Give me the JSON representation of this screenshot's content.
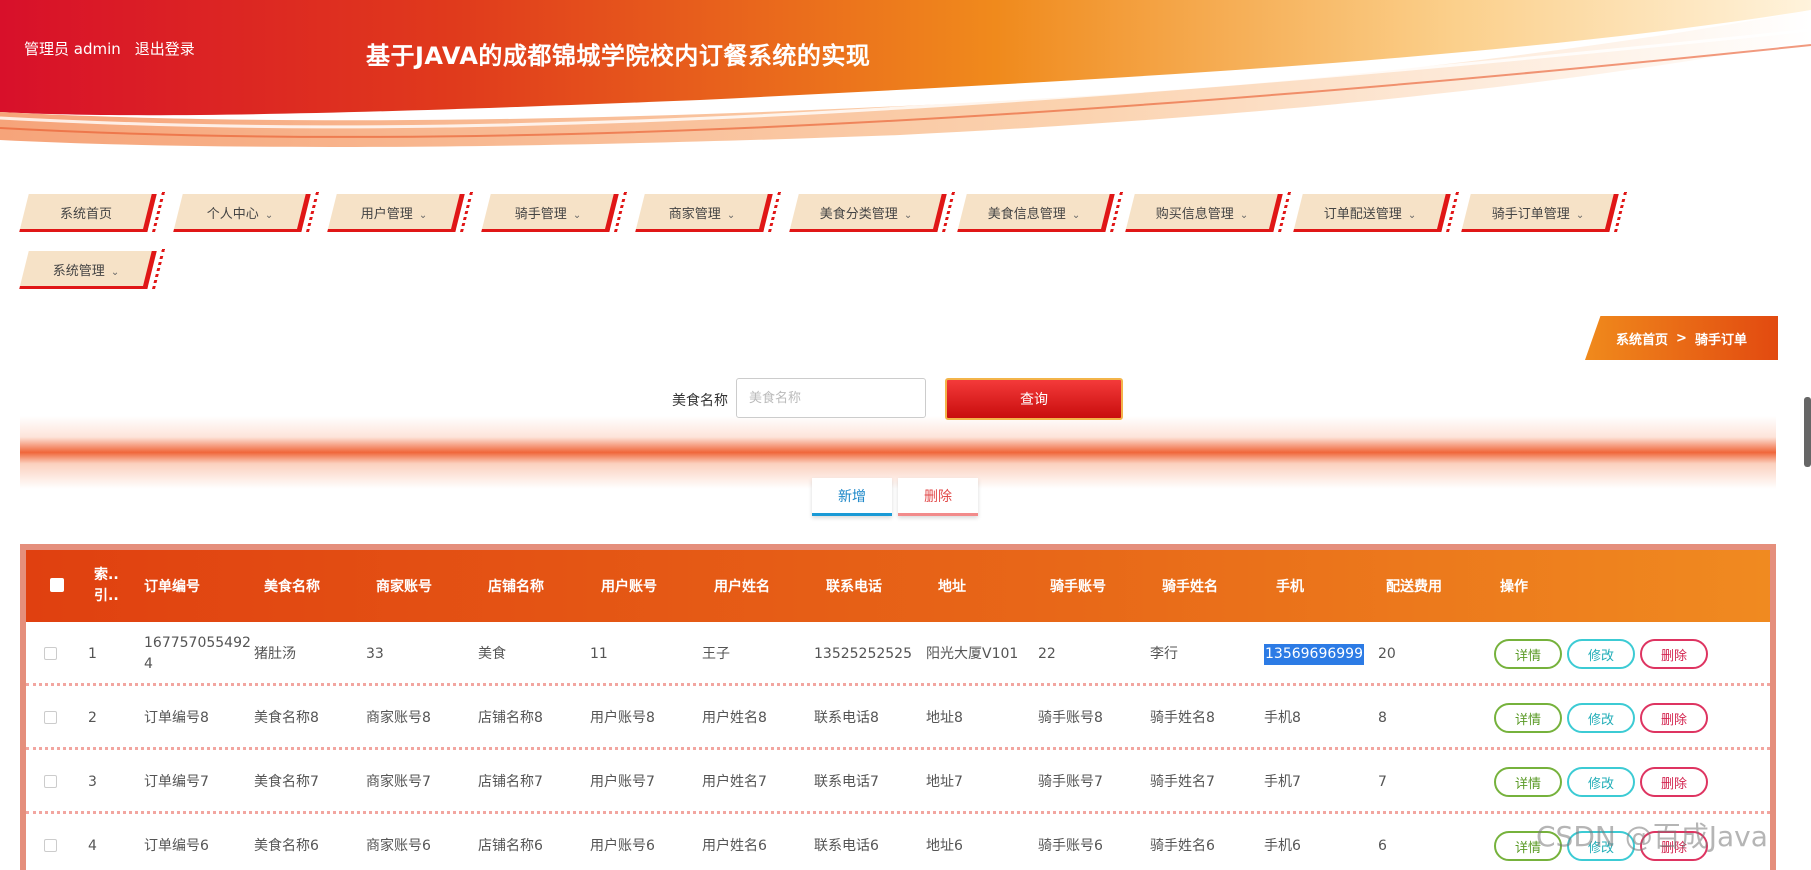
{
  "header": {
    "user_role": "管理员 admin",
    "logout": "退出登录",
    "title": "基于JAVA的成都锦城学院校内订餐系统的实现"
  },
  "nav": [
    {
      "label": "系统首页",
      "dropdown": false
    },
    {
      "label": "个人中心",
      "dropdown": true
    },
    {
      "label": "用户管理",
      "dropdown": true
    },
    {
      "label": "骑手管理",
      "dropdown": true
    },
    {
      "label": "商家管理",
      "dropdown": true
    },
    {
      "label": "美食分类管理",
      "dropdown": true
    },
    {
      "label": "美食信息管理",
      "dropdown": true
    },
    {
      "label": "购买信息管理",
      "dropdown": true
    },
    {
      "label": "订单配送管理",
      "dropdown": true
    },
    {
      "label": "骑手订单管理",
      "dropdown": true
    },
    {
      "label": "系统管理",
      "dropdown": true
    }
  ],
  "breadcrumb": {
    "home": "系统首页",
    "sep": ">",
    "current": "骑手订单"
  },
  "search": {
    "label": "美食名称",
    "placeholder": "美食名称",
    "button": "查询"
  },
  "actions": {
    "add": "新增",
    "delete": "删除"
  },
  "table": {
    "headers": [
      "索引",
      "订单编号",
      "美食名称",
      "商家账号",
      "店铺名称",
      "用户账号",
      "用户姓名",
      "联系电话",
      "地址",
      "骑手账号",
      "骑手姓名",
      "手机",
      "配送费用",
      "操作"
    ],
    "header_index_short": [
      "索..",
      "引.."
    ],
    "rows": [
      [
        "1",
        "1677570554924",
        "猪肚汤",
        "33",
        "美食",
        "11",
        "王子",
        "13525252525",
        "阳光大厦V101",
        "22",
        "李行",
        "13569696999",
        "20"
      ],
      [
        "2",
        "订单编号8",
        "美食名称8",
        "商家账号8",
        "店铺名称8",
        "用户账号8",
        "用户姓名8",
        "联系电话8",
        "地址8",
        "骑手账号8",
        "骑手姓名8",
        "手机8",
        "8"
      ],
      [
        "3",
        "订单编号7",
        "美食名称7",
        "商家账号7",
        "店铺名称7",
        "用户账号7",
        "用户姓名7",
        "联系电话7",
        "地址7",
        "骑手账号7",
        "骑手姓名7",
        "手机7",
        "7"
      ],
      [
        "4",
        "订单编号6",
        "美食名称6",
        "商家账号6",
        "店铺名称6",
        "用户账号6",
        "用户姓名6",
        "联系电话6",
        "地址6",
        "骑手账号6",
        "骑手姓名6",
        "手机6",
        "6"
      ]
    ],
    "row_actions": {
      "detail": "详情",
      "edit": "修改",
      "delete": "删除"
    }
  },
  "watermark": "CSDN @百成Java",
  "colors": {
    "primary": "#e01616",
    "accent": "#f08a1c",
    "nav_bg": "#f6e2c7"
  }
}
